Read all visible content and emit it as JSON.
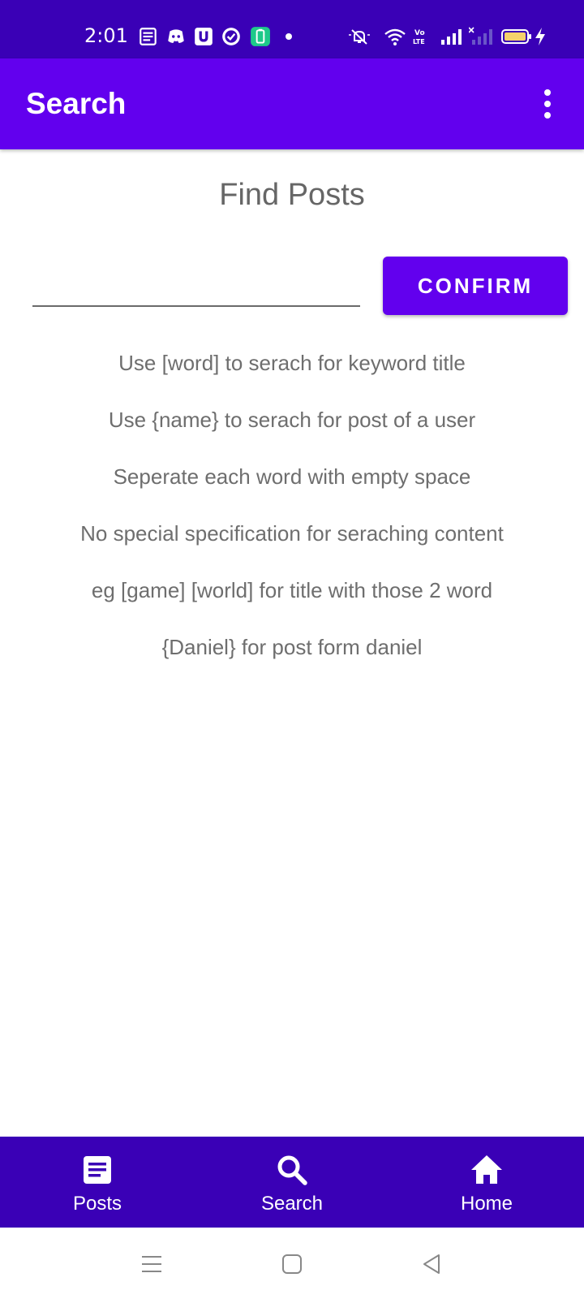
{
  "status_bar": {
    "time": "2:01",
    "left_icons": [
      "news-icon",
      "discord-icon",
      "u-app-icon",
      "check-badge-icon",
      "battery-app-icon",
      "dot-icon"
    ],
    "right_icons": [
      "mute-icon",
      "wifi-icon",
      "volte-icon",
      "signal-icon",
      "signal-no-service-icon",
      "battery-icon",
      "charging-icon"
    ]
  },
  "app_bar": {
    "title": "Search",
    "menu_icon": "more-vertical-icon"
  },
  "main": {
    "heading": "Find Posts",
    "search": {
      "value": "",
      "placeholder": ""
    },
    "confirm_label": "CONFIRM",
    "hints": [
      "Use [word] to serach for keyword title",
      "Use {name} to serach for post of a user",
      "Seperate each word with empty space",
      "No special specification for seraching content",
      "eg [game] [world] for title with those 2 word",
      "{Daniel} for post form daniel"
    ]
  },
  "bottom_nav": {
    "items": [
      {
        "label": "Posts",
        "icon": "document-icon"
      },
      {
        "label": "Search",
        "icon": "search-icon"
      },
      {
        "label": "Home",
        "icon": "home-icon"
      }
    ]
  },
  "system_nav": {
    "buttons": [
      "recents-icon",
      "home-square-icon",
      "back-icon"
    ]
  },
  "colors": {
    "status_bar": "#3a00b6",
    "app_bar": "#6200ee",
    "button": "#6200ee",
    "bottom_nav": "#3a00b6",
    "hint_text": "#6e6e6e"
  }
}
